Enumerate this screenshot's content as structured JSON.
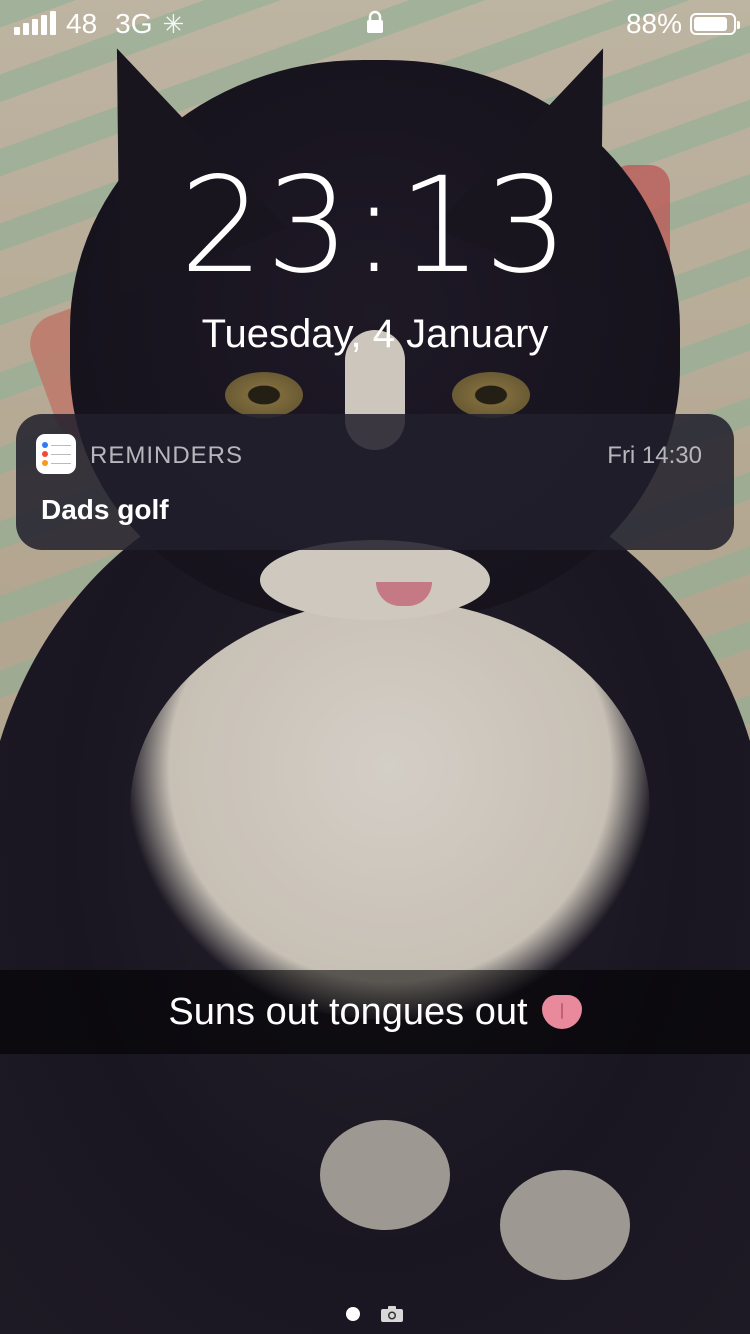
{
  "status_bar": {
    "signal_bars": 5,
    "carrier": "48",
    "network": "3G",
    "activity": "✳",
    "battery_text": "88%",
    "battery_level": 0.88,
    "icons": [
      "signal-icon",
      "activity-spinner-icon",
      "lock-icon",
      "battery-icon"
    ]
  },
  "lock_screen": {
    "time": "23:13",
    "date": "Tuesday, 4 January"
  },
  "notification": {
    "app_name": "REMINDERS",
    "time": "Fri 14:30",
    "title": "Dads golf",
    "app_icon": "reminders-app-icon"
  },
  "caption": {
    "text": "Suns out tongues out",
    "emoji": "tongue-emoji"
  },
  "page_indicator": {
    "active_page": 1,
    "icons": [
      "page-dot",
      "camera-icon"
    ]
  },
  "colors": {
    "notification_bg": "#22202C",
    "muted_text": "#B8B6BD",
    "text": "#FFFFFF"
  }
}
